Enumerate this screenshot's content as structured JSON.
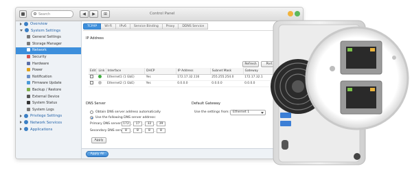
{
  "window": {
    "title": "Control Panel",
    "search_placeholder": "Search",
    "nav_back": "◀",
    "nav_forward": "▶",
    "nav_home": "⊞"
  },
  "sidebar": {
    "items": [
      {
        "label": "Overview",
        "level": "top",
        "color": "#3b7fc4",
        "expand": "right"
      },
      {
        "label": "System Settings",
        "level": "top",
        "color": "#3b7fc4",
        "expand": "down"
      },
      {
        "label": "General Settings",
        "level": "sub",
        "color": "#7a7a7a"
      },
      {
        "label": "Storage Manager",
        "level": "sub",
        "color": "#7a7a7a"
      },
      {
        "label": "Network",
        "level": "sub",
        "color": "#ffffff",
        "active": true
      },
      {
        "label": "Security",
        "level": "sub",
        "color": "#d9534f"
      },
      {
        "label": "Hardware",
        "level": "sub",
        "color": "#5b6fa8"
      },
      {
        "label": "Power",
        "level": "sub",
        "color": "#e0a21b"
      },
      {
        "label": "Notification",
        "level": "sub",
        "color": "#6a8fc8"
      },
      {
        "label": "Firmware Update",
        "level": "sub",
        "color": "#4b9ad8"
      },
      {
        "label": "Backup / Restore",
        "level": "sub",
        "color": "#7fae4a"
      },
      {
        "label": "External Device",
        "level": "sub",
        "color": "#555555"
      },
      {
        "label": "System Status",
        "level": "sub",
        "color": "#333333"
      },
      {
        "label": "System Logs",
        "level": "sub",
        "color": "#777777"
      },
      {
        "label": "Privilege Settings",
        "level": "top",
        "color": "#3b7fc4",
        "expand": "right"
      },
      {
        "label": "Network Services",
        "level": "top",
        "color": "#3b7fc4",
        "expand": "right"
      },
      {
        "label": "Applications",
        "level": "top",
        "color": "#3b7fc4",
        "expand": "right"
      }
    ]
  },
  "tabs": [
    "TCP/IP",
    "Wi-Fi",
    "IPv6",
    "Service Binding",
    "Proxy",
    "DDNS Service"
  ],
  "ip_section": {
    "title": "IP Address",
    "refresh_label": "Refresh",
    "port_trunking_label": "Port",
    "columns": [
      "Edit",
      "Link",
      "Interface",
      "DHCP",
      "IP Address",
      "Subnet Mask",
      "Gateway",
      "M"
    ],
    "rows": [
      {
        "link_color": "#3fae3f",
        "interface": "Ethernet1 (1 GbE)",
        "dhcp": "Yes",
        "ip": "172.17.32.116",
        "mask": "255.255.254.0",
        "gateway": "172.17.32.1",
        "m": "00"
      },
      {
        "link_color": "#bdbdbd",
        "interface": "Ethernet2 (1 GbE)",
        "dhcp": "Yes",
        "ip": "0.0.0.0",
        "mask": "0.0.0.0",
        "gateway": "0.0.0.0",
        "m": "00"
      }
    ]
  },
  "dns": {
    "title": "DNS Server",
    "opt_auto": "Obtain DNS server address automatically",
    "opt_manual": "Use the following DNS server address:",
    "primary_label": "Primary DNS server:",
    "secondary_label": "Secondary DNS server:",
    "primary": [
      "172",
      "17",
      "32",
      "39"
    ],
    "secondary": [
      "8",
      "8",
      "8",
      "8"
    ],
    "apply_label": "Apply"
  },
  "gateway": {
    "title": "Default Gateway",
    "use_label": "Use the settings from:",
    "selected": "Ethernet 1"
  },
  "footer": {
    "apply_all_label": "Apply All"
  },
  "colors": {
    "accent": "#3d8fdc",
    "traffic_yellow": "#f2b33c",
    "traffic_green": "#5cb85c",
    "traffic_blue": "#3f9be0"
  }
}
